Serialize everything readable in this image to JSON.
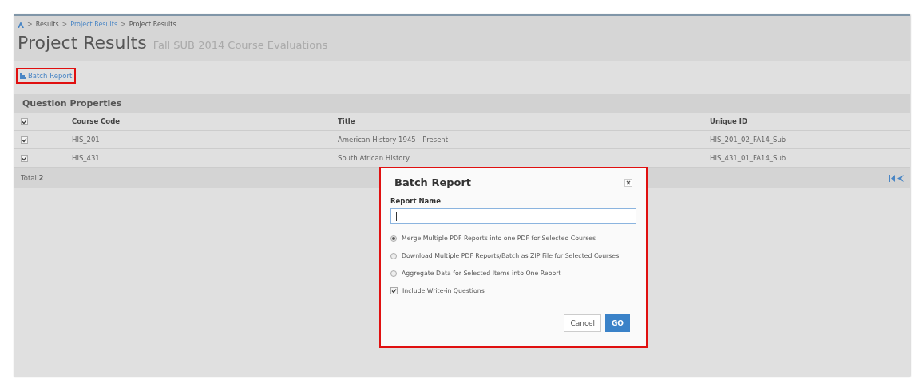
{
  "breadcrumb": [
    {
      "separator": ">",
      "label": "Results",
      "link": false
    },
    {
      "separator": ">",
      "label": "Project Results",
      "link": true
    },
    {
      "separator": ">",
      "label": "Project Results",
      "link": false
    }
  ],
  "page_title": "Project Results",
  "page_subtitle": "Fall SUB 2014 Course Evaluations",
  "toolbar": {
    "batch_report": "Batch Report"
  },
  "section": {
    "title": "Question Properties"
  },
  "table": {
    "all_checked": true,
    "columns": [
      "Course Code",
      "Title",
      "Unique ID"
    ],
    "rows": [
      {
        "checked": true,
        "cells": [
          "HIS_201",
          "American History 1945 - Present",
          "HIS_201_02_FA14_Sub"
        ]
      },
      {
        "checked": true,
        "cells": [
          "HIS_431",
          "South African History",
          "HIS_431_01_FA14_Sub"
        ]
      }
    ]
  },
  "footer": {
    "total_label": "Total",
    "total": "2"
  },
  "dialog": {
    "title": "Batch Report",
    "field_label": "Report Name",
    "options": [
      {
        "kind": "radio",
        "label": "Merge Multiple PDF Reports into one PDF for Selected Courses",
        "selected": true
      },
      {
        "kind": "radio",
        "label": "Download Multiple PDF Reports/Batch as ZIP File for Selected Courses",
        "selected": false
      },
      {
        "kind": "radio",
        "label": "Aggregate Data for Selected Items into One Report",
        "selected": false
      },
      {
        "kind": "checkbox",
        "label": "Include Write-in Questions",
        "checked": true
      }
    ],
    "buttons": [
      {
        "label": "Cancel",
        "primary": false
      },
      {
        "label": "GO",
        "primary": true
      }
    ]
  }
}
